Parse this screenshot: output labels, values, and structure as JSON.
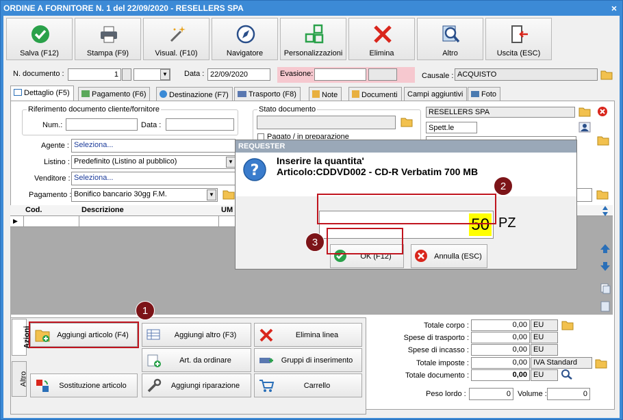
{
  "window": {
    "title": "ORDINE A FORNITORE N. 1 del 22/09/2020 - RESELLERS SPA",
    "close": "×"
  },
  "toolbar": [
    {
      "label": "Salva (F12)",
      "icon": "check-circle-icon",
      "color": "#2aa14a"
    },
    {
      "label": "Stampa (F9)",
      "icon": "printer-icon"
    },
    {
      "label": "Visual. (F10)",
      "icon": "magic-wand-icon"
    },
    {
      "label": "Navigatore",
      "icon": "compass-icon"
    },
    {
      "label": "Personalizzazioni",
      "icon": "grid-blocks-icon",
      "color": "#2aa14a"
    },
    {
      "label": "Elimina",
      "icon": "red-x-icon",
      "color": "#d9261c"
    },
    {
      "label": "Altro",
      "icon": "magnifier-icon"
    },
    {
      "label": "Uscita (ESC)",
      "icon": "exit-door-icon"
    }
  ],
  "header": {
    "n_documento_label": "N. documento :",
    "n_documento_value": "1",
    "data_label": "Data :",
    "data_value": "22/09/2020",
    "evasione_label": "Evasione:",
    "causale_label": "Causale :",
    "causale_value": "ACQUISTO"
  },
  "tabs": [
    {
      "label": "Dettaglio (F5)",
      "icon": "table-icon"
    },
    {
      "label": "Pagamento (F6)",
      "icon": "money-icon"
    },
    {
      "label": "Destinazione (F7)",
      "icon": "globe-icon"
    },
    {
      "label": "Trasporto (F8)",
      "icon": "truck-icon"
    },
    {
      "label": "Note",
      "icon": "note-icon"
    },
    {
      "label": "Documenti",
      "icon": "docs-icon"
    },
    {
      "label": "Campi aggiuntivi",
      "icon": ""
    },
    {
      "label": "Foto",
      "icon": "camera-icon"
    }
  ],
  "detail": {
    "rif_title": "Riferimento documento cliente/fornitore",
    "num_label": "Num.:",
    "data_label": "Data :",
    "stato_title": "Stato documento",
    "stato_check_label": "Pagato / in preparazione",
    "agente_label": "Agente :",
    "agente_value": "Seleziona...",
    "listino_label": "Listino :",
    "listino_value": "Predefinito (Listino al pubblico)",
    "venditore_label": "Venditore :",
    "venditore_value": "Seleziona...",
    "pagamento_label": "Pagamento :",
    "pagamento_value": "Bonifico bancario 30gg F.M.",
    "fornitore_value": "RESELLERS SPA",
    "spett_value": "Spett.le"
  },
  "grid": {
    "columns": [
      "Cod.",
      "Descrizione",
      "UM"
    ]
  },
  "side_tabs": {
    "azioni": "Azioni",
    "altro": "Altro"
  },
  "actions": [
    {
      "label": "Aggiungi articolo (F4)",
      "icon": "folder-add-icon"
    },
    {
      "label": "Aggiungi altro (F3)",
      "icon": "table-add-icon"
    },
    {
      "label": "Elimina linea",
      "icon": "red-x-icon"
    },
    {
      "label": "Art. da ordinare",
      "icon": "cart-add-icon"
    },
    {
      "label": "Gruppi di inserimento",
      "icon": "group-insert-icon"
    },
    {
      "label": "Sostituzione articolo",
      "icon": "swap-icon"
    },
    {
      "label": "Aggiungi riparazione",
      "icon": "wrench-icon"
    },
    {
      "label": "Carrello",
      "icon": "cart-icon"
    }
  ],
  "totals": [
    {
      "label": "Totale corpo :",
      "value": "0,00",
      "unit": "EU"
    },
    {
      "label": "Spese di trasporto :",
      "value": "0,00",
      "unit": "EU"
    },
    {
      "label": "Spese di incasso :",
      "value": "0,00",
      "unit": "EU"
    },
    {
      "label": "Totale imposte :",
      "value": "0,00",
      "unit": "IVA Standard"
    },
    {
      "label": "Totale documento :",
      "value": "0,00",
      "unit": "EU"
    }
  ],
  "weights": {
    "peso_label": "Peso lordo :",
    "peso_value": "0",
    "volume_label": "Volume :",
    "volume_value": "0"
  },
  "dialog": {
    "title": "REQUESTER",
    "line1": "Inserire la quantita'",
    "line2": "Articolo:CDDVD002 - CD-R Verbatim 700 MB",
    "qty_value": "50",
    "unit": "PZ",
    "ok_label": "OK (F12)",
    "cancel_label": "Annulla (ESC)"
  },
  "badges": [
    "1",
    "2",
    "3"
  ],
  "colors": {
    "highlight_red": "#c0141e",
    "evasione_bg": "#f6c8cf",
    "qty_bg": "#ffff00"
  }
}
